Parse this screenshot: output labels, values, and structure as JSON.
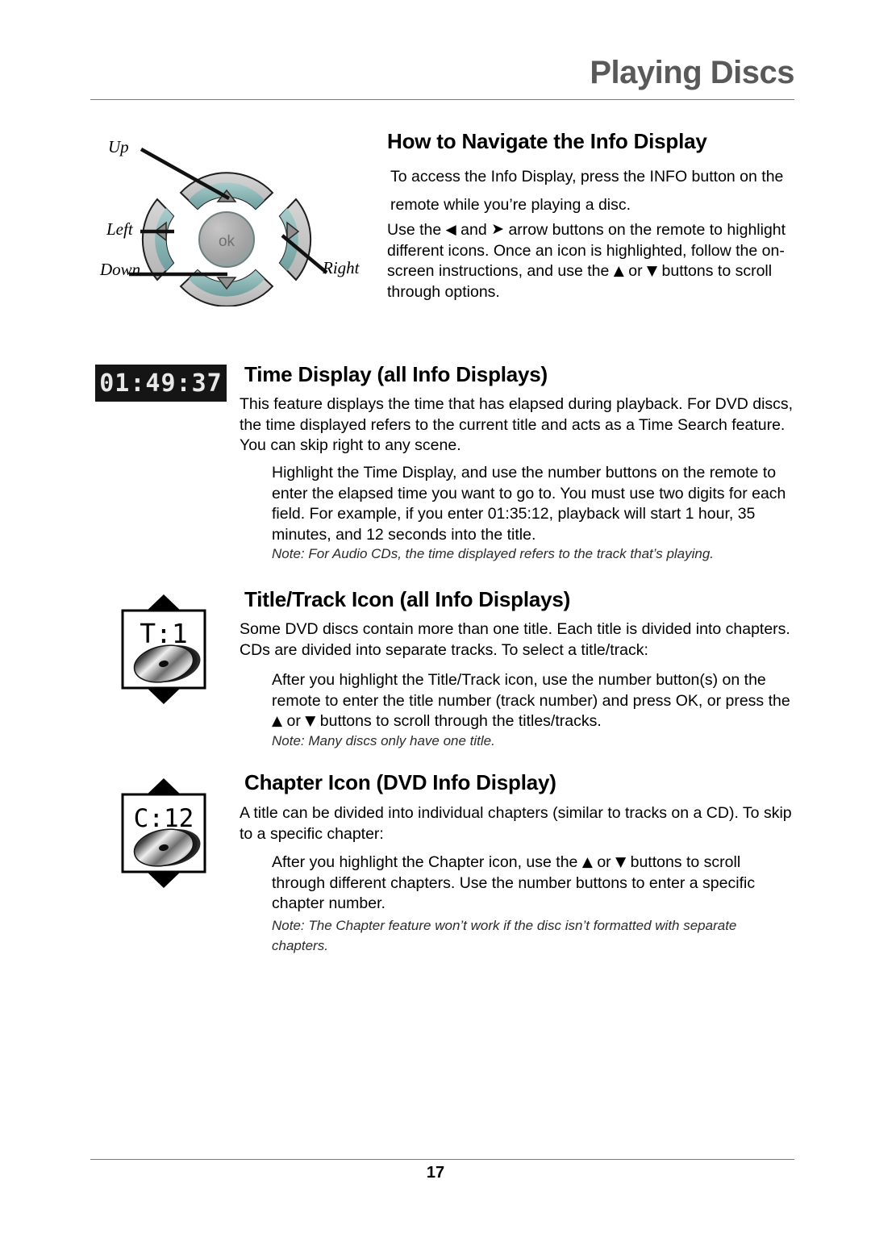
{
  "header": {
    "title": "Playing Discs"
  },
  "nav_diagram": {
    "label_up": "Up",
    "label_left": "Left",
    "label_down": "Down",
    "label_right": "Right",
    "center_button": "ok",
    "colors": {
      "pad_gray": "#c9c9c9",
      "pad_teal": "#8fb8b8",
      "pad_outline": "#1a1a1a",
      "center_fill": "#a8a8a8"
    }
  },
  "sections": {
    "navigate": {
      "heading": "How to Navigate the Info Display",
      "paragraph1_line1": "To access the Info Display, press the INFO button on the",
      "paragraph1_line2": "remote while you’re playing a disc.",
      "paragraph2_pre": "Use the",
      "paragraph2_mid": "and",
      "paragraph2_post": "arrow buttons on the remote to highlight different icons. Once an icon is highlighted, follow the on-screen instructions, and use the",
      "paragraph2_or": "or",
      "paragraph2_end": "buttons to scroll through options.",
      "icon_left": "◀",
      "icon_right": "➤",
      "icon_up": "▲",
      "icon_down": "▼"
    },
    "time_display": {
      "heading": "Time Display (all Info Displays)",
      "lcd_value": "01:49:37",
      "paragraph": "This feature displays the time that has elapsed during playback. For DVD discs, the time displayed refers to the current title and acts as a Time Search feature. You can skip right to any scene.",
      "indented_paragraph": "Highlight the Time Display, and use the number buttons on the remote to enter the elapsed time you want to go to. You must use two digits for each field. For example, if you enter 01:35:12, playback will start 1 hour, 35 minutes, and 12 seconds into the title.",
      "note": "Note: For Audio CDs, the time displayed refers to the track that’s playing."
    },
    "title_track": {
      "heading": "Title/Track Icon (all Info Displays)",
      "icon_label": "T:1",
      "paragraph": "Some DVD discs contain more than one title. Each title is divided into chapters. CDs are divided into separate tracks. To select a title/track:",
      "indented_pre": "After you highlight the Title/Track icon, use the number button(s) on the remote to enter the title number (track number) and press OK, or press the",
      "indented_or": "or",
      "indented_end": "buttons to scroll through the titles/tracks.",
      "note": "Note: Many discs only have one title."
    },
    "chapter": {
      "heading": "Chapter Icon (DVD Info Display)",
      "icon_label": "C:12",
      "paragraph": "A title can be divided into individual chapters (similar to tracks on a CD). To skip to a specific chapter:",
      "indented_pre": "After you highlight the Chapter icon, use the",
      "indented_or": "or",
      "indented_end": "buttons to scroll through different chapters. Use the number buttons to enter a specific chapter number.",
      "note": "Note: The Chapter feature won’t work if the disc isn’t formatted with separate chapters."
    }
  },
  "footer": {
    "page_number": "17"
  }
}
